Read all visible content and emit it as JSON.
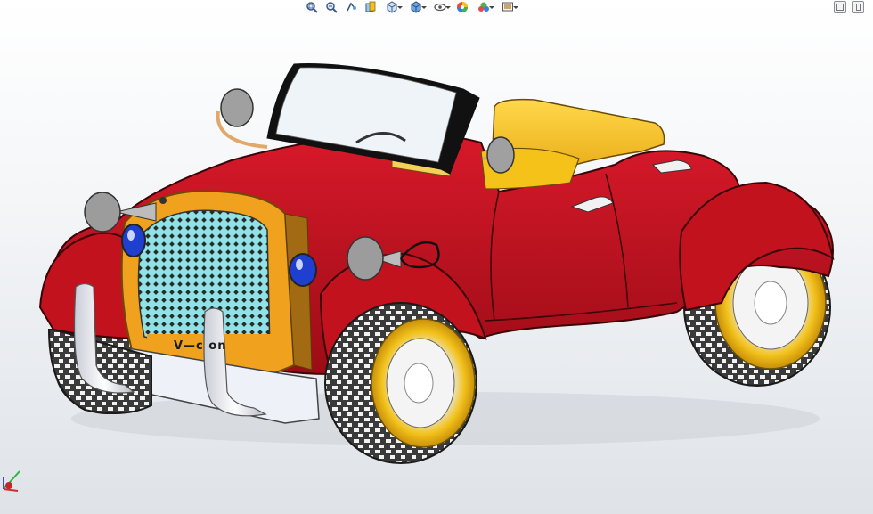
{
  "toolbar": {
    "items": [
      {
        "icon": "zoom-to-fit-icon",
        "dropdown": false
      },
      {
        "icon": "zoom-to-area-icon",
        "dropdown": false
      },
      {
        "icon": "previous-view-icon",
        "dropdown": false
      },
      {
        "icon": "section-view-icon",
        "dropdown": false
      },
      {
        "icon": "view-orientation-icon",
        "dropdown": true
      },
      {
        "icon": "display-style-icon",
        "dropdown": true
      },
      {
        "icon": "hide-show-items-icon",
        "dropdown": true
      },
      {
        "icon": "edit-appearance-icon",
        "dropdown": false
      },
      {
        "icon": "apply-scene-icon",
        "dropdown": true
      },
      {
        "icon": "view-settings-icon",
        "dropdown": true
      }
    ]
  },
  "window_controls": [
    "restore-pane-icon",
    "split-pane-icon"
  ],
  "model": {
    "grille_text": "V—c   on",
    "colors": {
      "body": "#c0101c",
      "body_shadow": "#7d0a12",
      "seat": "#f5c21a",
      "grille_frame": "#f0a21e",
      "grille_mesh": "#8fe3e6",
      "lamp_blue": "#1f3fd0",
      "tire": "#2f2f2f",
      "rim": "#f2c21b",
      "chrome": "#e6e8ee",
      "bumper": "#eef1f8"
    }
  }
}
